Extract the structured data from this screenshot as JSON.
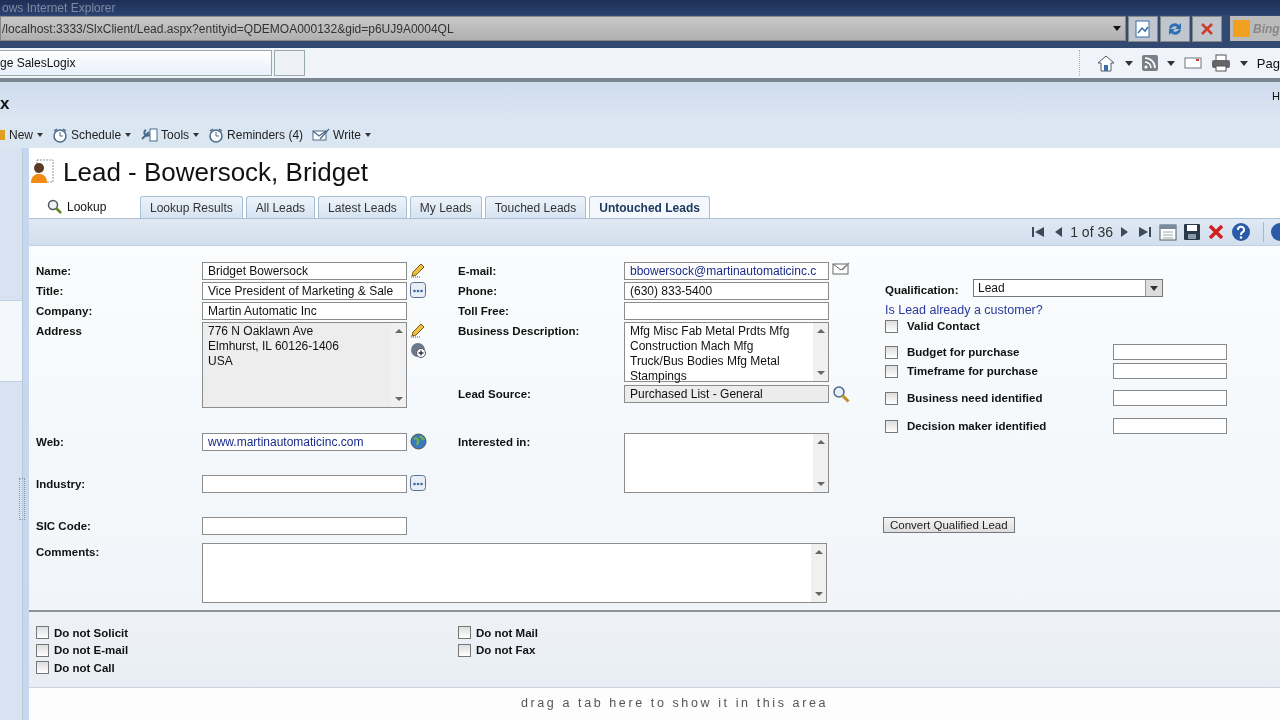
{
  "browser": {
    "title": "ows Internet Explorer",
    "address": "/localhost:3333/SlxClient/Lead.aspx?entityid=QDEMOA000132&gid=p6UJ9A0004QL",
    "search_provider": "Bing",
    "tabs": [
      {
        "label": "ge SalesLogix",
        "selected": true
      }
    ],
    "command_bar": [
      {
        "kind": "home",
        "dropdown": true
      },
      {
        "kind": "feed",
        "dropdown": true
      },
      {
        "kind": "mail",
        "dropdown": false
      },
      {
        "kind": "print",
        "dropdown": true
      }
    ],
    "page_menu": "Pag"
  },
  "app": {
    "title": "x",
    "corner": "H"
  },
  "menu": [
    {
      "label": "New",
      "dropdown": true
    },
    {
      "label": "Schedule",
      "dropdown": true
    },
    {
      "label": "Tools",
      "dropdown": true
    },
    {
      "label": "Reminders (4)",
      "dropdown": false
    },
    {
      "label": "Write",
      "dropdown": true
    }
  ],
  "record": {
    "title": "Lead - Bowersock, Bridget",
    "lookup": "Lookup",
    "tabs": [
      {
        "label": "Lookup Results",
        "selected": false
      },
      {
        "label": "All Leads",
        "selected": false
      },
      {
        "label": "Latest Leads",
        "selected": false
      },
      {
        "label": "My Leads",
        "selected": false
      },
      {
        "label": "Touched Leads",
        "selected": false
      },
      {
        "label": "Untouched Leads",
        "selected": true
      }
    ],
    "pager": "1 of 36"
  },
  "form": {
    "left": [
      {
        "label": "Name:",
        "kind": "text",
        "value": "Bridget Bowersock"
      },
      {
        "label": "Title:",
        "kind": "text",
        "value": "Vice President of Marketing & Sale"
      },
      {
        "label": "Company:",
        "kind": "text",
        "value": "Martin Automatic Inc"
      },
      {
        "label": "Address",
        "kind": "memo",
        "readonly": true,
        "value": "776 N Oaklawn Ave\nElmhurst, IL 60126-1406\nUSA"
      },
      {
        "label": "Web:",
        "kind": "link",
        "value": "www.martinautomaticinc.com"
      },
      {
        "label": "Industry:",
        "kind": "text"
      },
      {
        "label": "SIC Code:",
        "kind": "text"
      }
    ],
    "middle": [
      {
        "label": "E-mail:",
        "kind": "link",
        "value": "bbowersock@martinautomaticinc.c"
      },
      {
        "label": "Phone:",
        "kind": "text",
        "value": "(630) 833-5400"
      },
      {
        "label": "Toll Free:",
        "kind": "text"
      },
      {
        "label": "Business Description:",
        "kind": "memo",
        "readonly": false,
        "value": "Mfg Misc Fab Metal Prdts Mfg\nConstruction Mach Mfg\nTruck/Bus Bodies Mfg Metal\nStampings"
      },
      {
        "label": "Lead Source:",
        "kind": "readonly",
        "value": "Purchased List - General"
      },
      {
        "label": "Interested in:",
        "kind": "memo",
        "readonly": false
      }
    ],
    "comments": {
      "label": "Comments:"
    },
    "qualification": {
      "label": "Qualification:",
      "value": "Lead"
    },
    "customer_link": "Is Lead already a customer?",
    "criteria": [
      {
        "label": "Valid Contact",
        "kind": "check",
        "checked": false
      },
      {
        "label": "Budget for purchase",
        "kind": "check_text",
        "checked": false
      },
      {
        "label": "Timeframe for purchase",
        "kind": "check_text",
        "checked": false
      },
      {
        "label": "Business need identified",
        "kind": "check_text",
        "checked": false
      },
      {
        "label": "Decision maker identified",
        "kind": "check_text",
        "checked": false
      }
    ],
    "convert_button": "Convert Qualified Lead"
  },
  "preferences": [
    {
      "label": "Do not Solicit",
      "checked": false
    },
    {
      "label": "Do not Mail",
      "checked": false
    },
    {
      "label": "Do not E-mail",
      "checked": false
    },
    {
      "label": "Do not Fax",
      "checked": false
    },
    {
      "label": "Do not Call",
      "checked": false
    }
  ],
  "drop_hint": "drag a tab here to show it in this area"
}
